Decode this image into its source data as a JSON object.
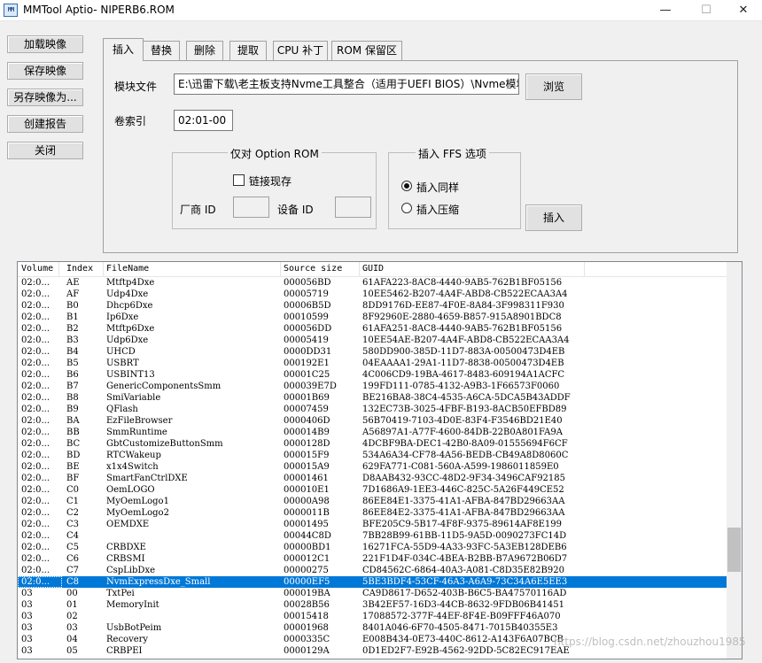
{
  "window": {
    "title": "MMTool Aptio- NIPERB6.ROM",
    "icon_text": "MM",
    "minimize_glyph": "—",
    "maximize_glyph": "☐",
    "close_glyph": "✕"
  },
  "sidebar": {
    "load_image": "加载映像",
    "save_image": "保存映像",
    "save_image_as": "另存映像为...",
    "create_report": "创建报告",
    "close": "关闭"
  },
  "tabs": [
    {
      "label": "插入",
      "active": true
    },
    {
      "label": "替换"
    },
    {
      "label": "删除"
    },
    {
      "label": "提取"
    },
    {
      "label": "CPU 补丁"
    },
    {
      "label": "ROM 保留区"
    }
  ],
  "insert_panel": {
    "module_file_label": "模块文件",
    "module_file_value": "E:\\迅雷下载\\老主板支持Nvme工具整合（适用于UEFI BIOS）\\Nvme模块",
    "browse_button": "浏览",
    "volume_index_label": "卷索引",
    "volume_index_value": "02:01-00",
    "option_rom_group": "仅对 Option ROM",
    "link_present_label": "链接现存",
    "vendor_id_label": "厂商 ID",
    "device_id_label": "设备 ID",
    "ffs_group": "插入 FFS 选项",
    "insert_same_label": "插入同样",
    "insert_compressed_label": "插入压缩",
    "insert_button": "插入"
  },
  "table": {
    "columns": [
      "Volume",
      "Index",
      "FileName",
      "Source size",
      "GUID"
    ],
    "rows": [
      [
        "02:0...",
        "AE",
        "Mtftp4Dxe",
        "000056BD",
        "61AFA223-8AC8-4440-9AB5-762B1BF05156"
      ],
      [
        "02:0...",
        "AF",
        "Udp4Dxe",
        "00005719",
        "10EE5462-B207-4A4F-ABD8-CB522ECAA3A4"
      ],
      [
        "02:0...",
        "B0",
        "Dhcp6Dxe",
        "00006B5D",
        "8DD9176D-EE87-4F0E-8A84-3F998311F930"
      ],
      [
        "02:0...",
        "B1",
        "Ip6Dxe",
        "00010599",
        "8F92960E-2880-4659-B857-915A8901BDC8"
      ],
      [
        "02:0...",
        "B2",
        "Mtftp6Dxe",
        "000056DD",
        "61AFA251-8AC8-4440-9AB5-762B1BF05156"
      ],
      [
        "02:0...",
        "B3",
        "Udp6Dxe",
        "00005419",
        "10EE54AE-B207-4A4F-ABD8-CB522ECAA3A4"
      ],
      [
        "02:0...",
        "B4",
        "UHCD",
        "0000DD31",
        "580DD900-385D-11D7-883A-00500473D4EB"
      ],
      [
        "02:0...",
        "B5",
        "USBRT",
        "000192E1",
        "04EAAAA1-29A1-11D7-8838-00500473D4EB"
      ],
      [
        "02:0...",
        "B6",
        "USBINT13",
        "00001C25",
        "4C006CD9-19BA-4617-8483-609194A1ACFC"
      ],
      [
        "02:0...",
        "B7",
        "GenericComponentsSmm",
        "000039E7D",
        "199FD111-0785-4132-A9B3-1F66573F0060"
      ],
      [
        "02:0...",
        "B8",
        "SmiVariable",
        "00001B69",
        "BE216BA8-38C4-4535-A6CA-5DCA5B43ADDF"
      ],
      [
        "02:0...",
        "B9",
        "QFlash",
        "00007459",
        "132EC73B-3025-4FBF-B193-8ACB50EFBD89"
      ],
      [
        "02:0...",
        "BA",
        "EzFileBrowser",
        "0000406D",
        "56B70419-7103-4D0E-83F4-F3546BD21E40"
      ],
      [
        "02:0...",
        "BB",
        "SmmRuntime",
        "000014B9",
        "A56897A1-A77F-4600-84DB-22B0A801FA9A"
      ],
      [
        "02:0...",
        "BC",
        "GbtCustomizeButtonSmm",
        "0000128D",
        "4DCBF9BA-DEC1-42B0-8A09-01555694F6CF"
      ],
      [
        "02:0...",
        "BD",
        "RTCWakeup",
        "000015F9",
        "534A6A34-CF78-4A56-BEDB-CB49A8D8060C"
      ],
      [
        "02:0...",
        "BE",
        "x1x4Switch",
        "000015A9",
        "629FA771-C081-560A-A599-1986011859E0"
      ],
      [
        "02:0...",
        "BF",
        "SmartFanCtrlDXE",
        "00001461",
        "D8AAB432-93CC-48D2-9F34-3496CAF92185"
      ],
      [
        "02:0...",
        "C0",
        "OemLOGO",
        "000010E1",
        "7D1686A9-1EE3-446C-825C-5A26F449CE52"
      ],
      [
        "02:0...",
        "C1",
        "MyOemLogo1",
        "00000A98",
        "86EE84E1-3375-41A1-AFBA-847BD29663AA"
      ],
      [
        "02:0...",
        "C2",
        "MyOemLogo2",
        "0000011B",
        "86EE84E2-3375-41A1-AFBA-847BD29663AA"
      ],
      [
        "02:0...",
        "C3",
        "OEMDXE",
        "00001495",
        "BFE205C9-5B17-4F8F-9375-89614AF8E199"
      ],
      [
        "02:0...",
        "C4",
        "",
        "00044C8D",
        "7BB28B99-61BB-11D5-9A5D-0090273FC14D"
      ],
      [
        "02:0...",
        "C5",
        "CRBDXE",
        "00000BD1",
        "16271FCA-55D9-4A33-93FC-5A3EB128DEB6"
      ],
      [
        "02:0...",
        "C6",
        "CRBSMI",
        "000012C1",
        "221F1D4F-034C-4BEA-B2BB-B7A9672B06D7"
      ],
      [
        "02:0...",
        "C7",
        "CspLibDxe",
        "00000275",
        "CD84562C-6864-40A3-A081-C8D35E82B920"
      ],
      [
        "02:0...",
        "C8",
        "NvmExpressDxe_Small",
        "00000EF5",
        "5BE3BDF4-53CF-46A3-A6A9-73C34A6E5EE3"
      ],
      [
        "03",
        "00",
        "TxtPei",
        "000019BA",
        "CA9D8617-D652-403B-B6C5-BA47570116AD"
      ],
      [
        "03",
        "01",
        "MemoryInit",
        "00028B56",
        "3B42EF57-16D3-44CB-8632-9FDB06B41451"
      ],
      [
        "03",
        "02",
        "",
        "00015418",
        "17088572-377F-44EF-8F4E-B09FFF46A070"
      ],
      [
        "03",
        "03",
        "UsbBotPeim",
        "00001968",
        "8401A046-6F70-4505-8471-7015B40355E3"
      ],
      [
        "03",
        "04",
        "Recovery",
        "0000335C",
        "E008B434-0E73-440C-8612-A143F6A07BCB"
      ],
      [
        "03",
        "05",
        "CRBPEI",
        "0000129A",
        "0D1ED2F7-E92B-4562-92DD-5C82EC917EAE"
      ]
    ],
    "selected_index": 26
  },
  "watermark": "https://blog.csdn.net/zhouzhou1985"
}
